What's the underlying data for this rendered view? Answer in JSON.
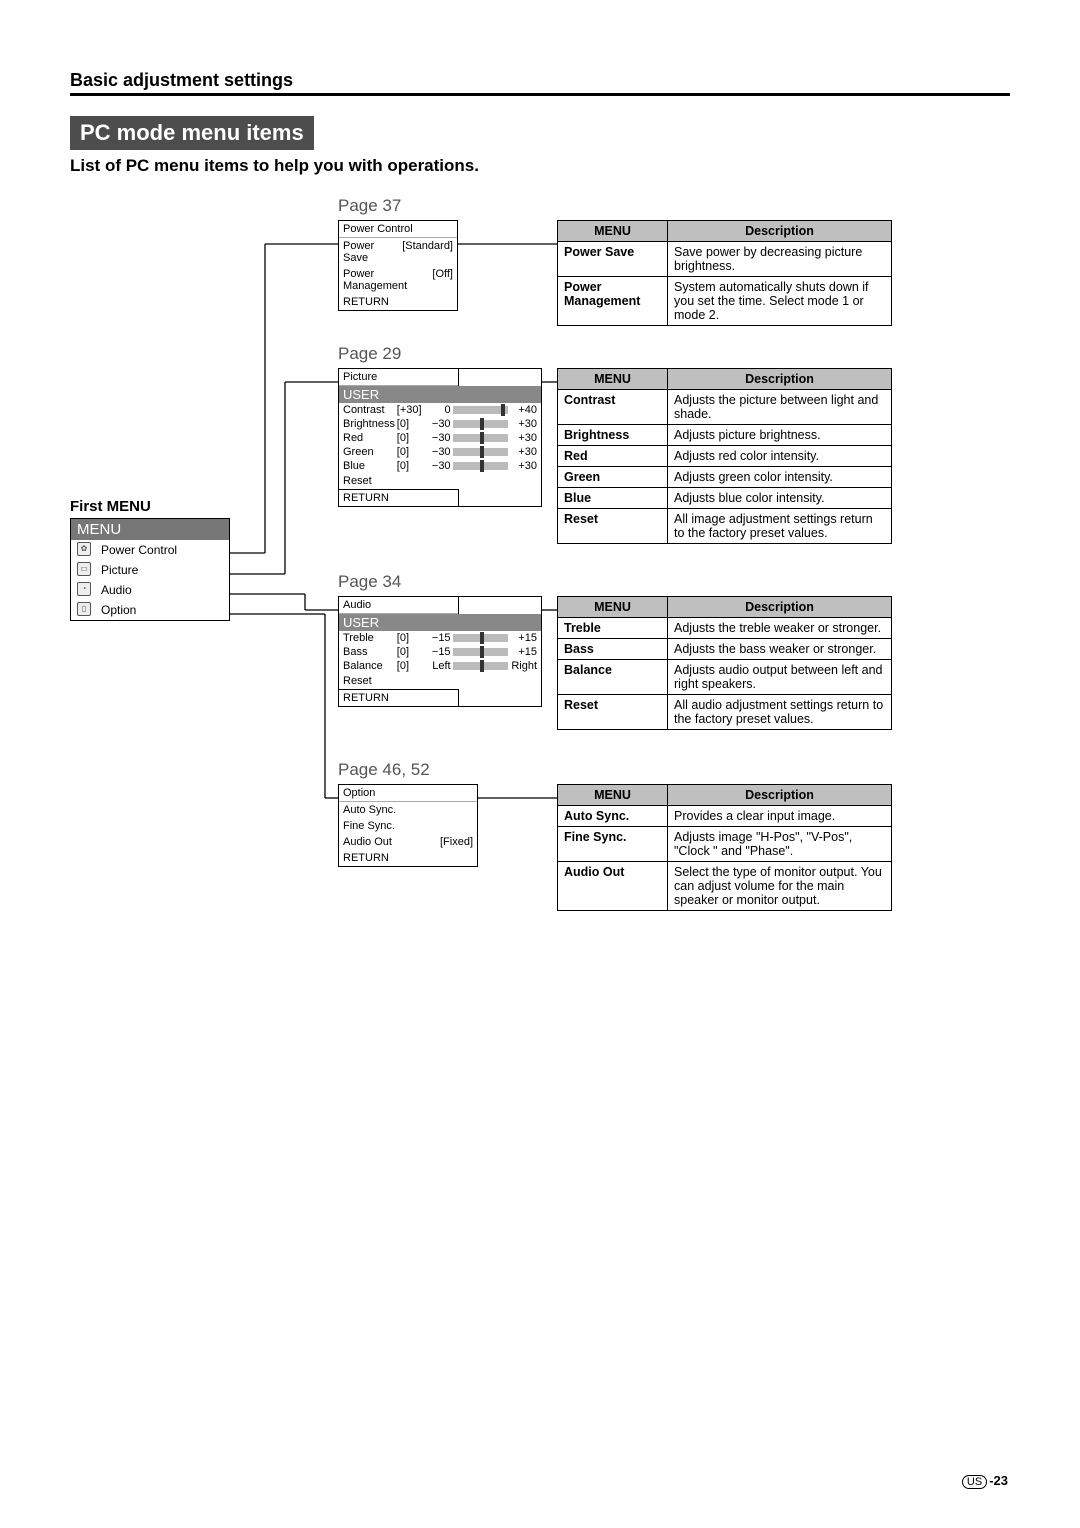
{
  "header": {
    "breadcrumb": "Basic adjustment settings",
    "title": "PC mode menu items",
    "subtitle": "List of PC menu items to help you with operations."
  },
  "first_menu": {
    "label": "First MENU",
    "header": "MENU",
    "items": [
      "Power Control",
      "Picture",
      "Audio",
      "Option"
    ]
  },
  "sections": [
    {
      "page_label": "Page 37",
      "menu": {
        "title": "Power Control",
        "rows": [
          {
            "label": "Power Save",
            "value": "[Standard]"
          },
          {
            "label": "Power Management",
            "value": "[Off]"
          },
          {
            "label": "RETURN",
            "value": ""
          }
        ]
      },
      "table_header": {
        "col1": "MENU",
        "col2": "Description"
      },
      "table_rows": [
        {
          "m": "Power Save",
          "d": "Save power by decreasing picture brightness."
        },
        {
          "m": "Power Management",
          "d": "System automatically shuts down if you set the time. Select mode 1 or mode 2."
        }
      ]
    },
    {
      "page_label": "Page 29",
      "menu": {
        "title": "Picture",
        "user": "USER",
        "sliders": [
          {
            "label": "Contrast",
            "val": "[+30]",
            "lo": "0",
            "hi": "+40",
            "thumb": 88
          },
          {
            "label": "Brightness",
            "val": "[0]",
            "lo": "−30",
            "hi": "+30",
            "thumb": 50
          },
          {
            "label": "Red",
            "val": "[0]",
            "lo": "−30",
            "hi": "+30",
            "thumb": 50
          },
          {
            "label": "Green",
            "val": "[0]",
            "lo": "−30",
            "hi": "+30",
            "thumb": 50
          },
          {
            "label": "Blue",
            "val": "[0]",
            "lo": "−30",
            "hi": "+30",
            "thumb": 50
          }
        ],
        "footer": [
          "Reset",
          "RETURN"
        ]
      },
      "table_header": {
        "col1": "MENU",
        "col2": "Description"
      },
      "table_rows": [
        {
          "m": "Contrast",
          "d": "Adjusts the picture between light and shade."
        },
        {
          "m": "Brightness",
          "d": "Adjusts picture brightness."
        },
        {
          "m": "Red",
          "d": "Adjusts red color intensity."
        },
        {
          "m": "Green",
          "d": "Adjusts green color intensity."
        },
        {
          "m": "Blue",
          "d": "Adjusts blue color intensity."
        },
        {
          "m": "Reset",
          "d": "All image adjustment settings return to the factory preset values."
        }
      ]
    },
    {
      "page_label": "Page 34",
      "menu": {
        "title": "Audio",
        "user": "USER",
        "sliders": [
          {
            "label": "Treble",
            "val": "[0]",
            "lo": "−15",
            "hi": "+15",
            "thumb": 50
          },
          {
            "label": "Bass",
            "val": "[0]",
            "lo": "−15",
            "hi": "+15",
            "thumb": 50
          },
          {
            "label": "Balance",
            "val": "[0]",
            "lo": "Left",
            "hi": "Right",
            "thumb": 50
          }
        ],
        "footer": [
          "Reset",
          "RETURN"
        ]
      },
      "table_header": {
        "col1": "MENU",
        "col2": "Description"
      },
      "table_rows": [
        {
          "m": "Treble",
          "d": "Adjusts the treble weaker or stronger."
        },
        {
          "m": "Bass",
          "d": "Adjusts the bass weaker or stronger."
        },
        {
          "m": "Balance",
          "d": "Adjusts audio output between left and right speakers."
        },
        {
          "m": "Reset",
          "d": "All audio adjustment settings return to the factory preset values."
        }
      ]
    },
    {
      "page_label": "Page 46, 52",
      "menu": {
        "title": "Option",
        "rows": [
          {
            "label": "Auto Sync.",
            "value": ""
          },
          {
            "label": "Fine Sync.",
            "value": ""
          },
          {
            "label": "Audio Out",
            "value": "[Fixed]"
          },
          {
            "label": "RETURN",
            "value": ""
          }
        ]
      },
      "table_header": {
        "col1": "MENU",
        "col2": "Description"
      },
      "table_rows": [
        {
          "m": "Auto Sync.",
          "d": "Provides a clear input image."
        },
        {
          "m": "Fine Sync.",
          "d": "Adjusts image \"H-Pos\", \"V-Pos\", \"Clock \" and \"Phase\"."
        },
        {
          "m": "Audio Out",
          "d": "Select the type of monitor output. You can adjust volume for the main speaker or monitor output."
        }
      ]
    }
  ],
  "page_footer": {
    "region": "US",
    "page": "-23"
  }
}
